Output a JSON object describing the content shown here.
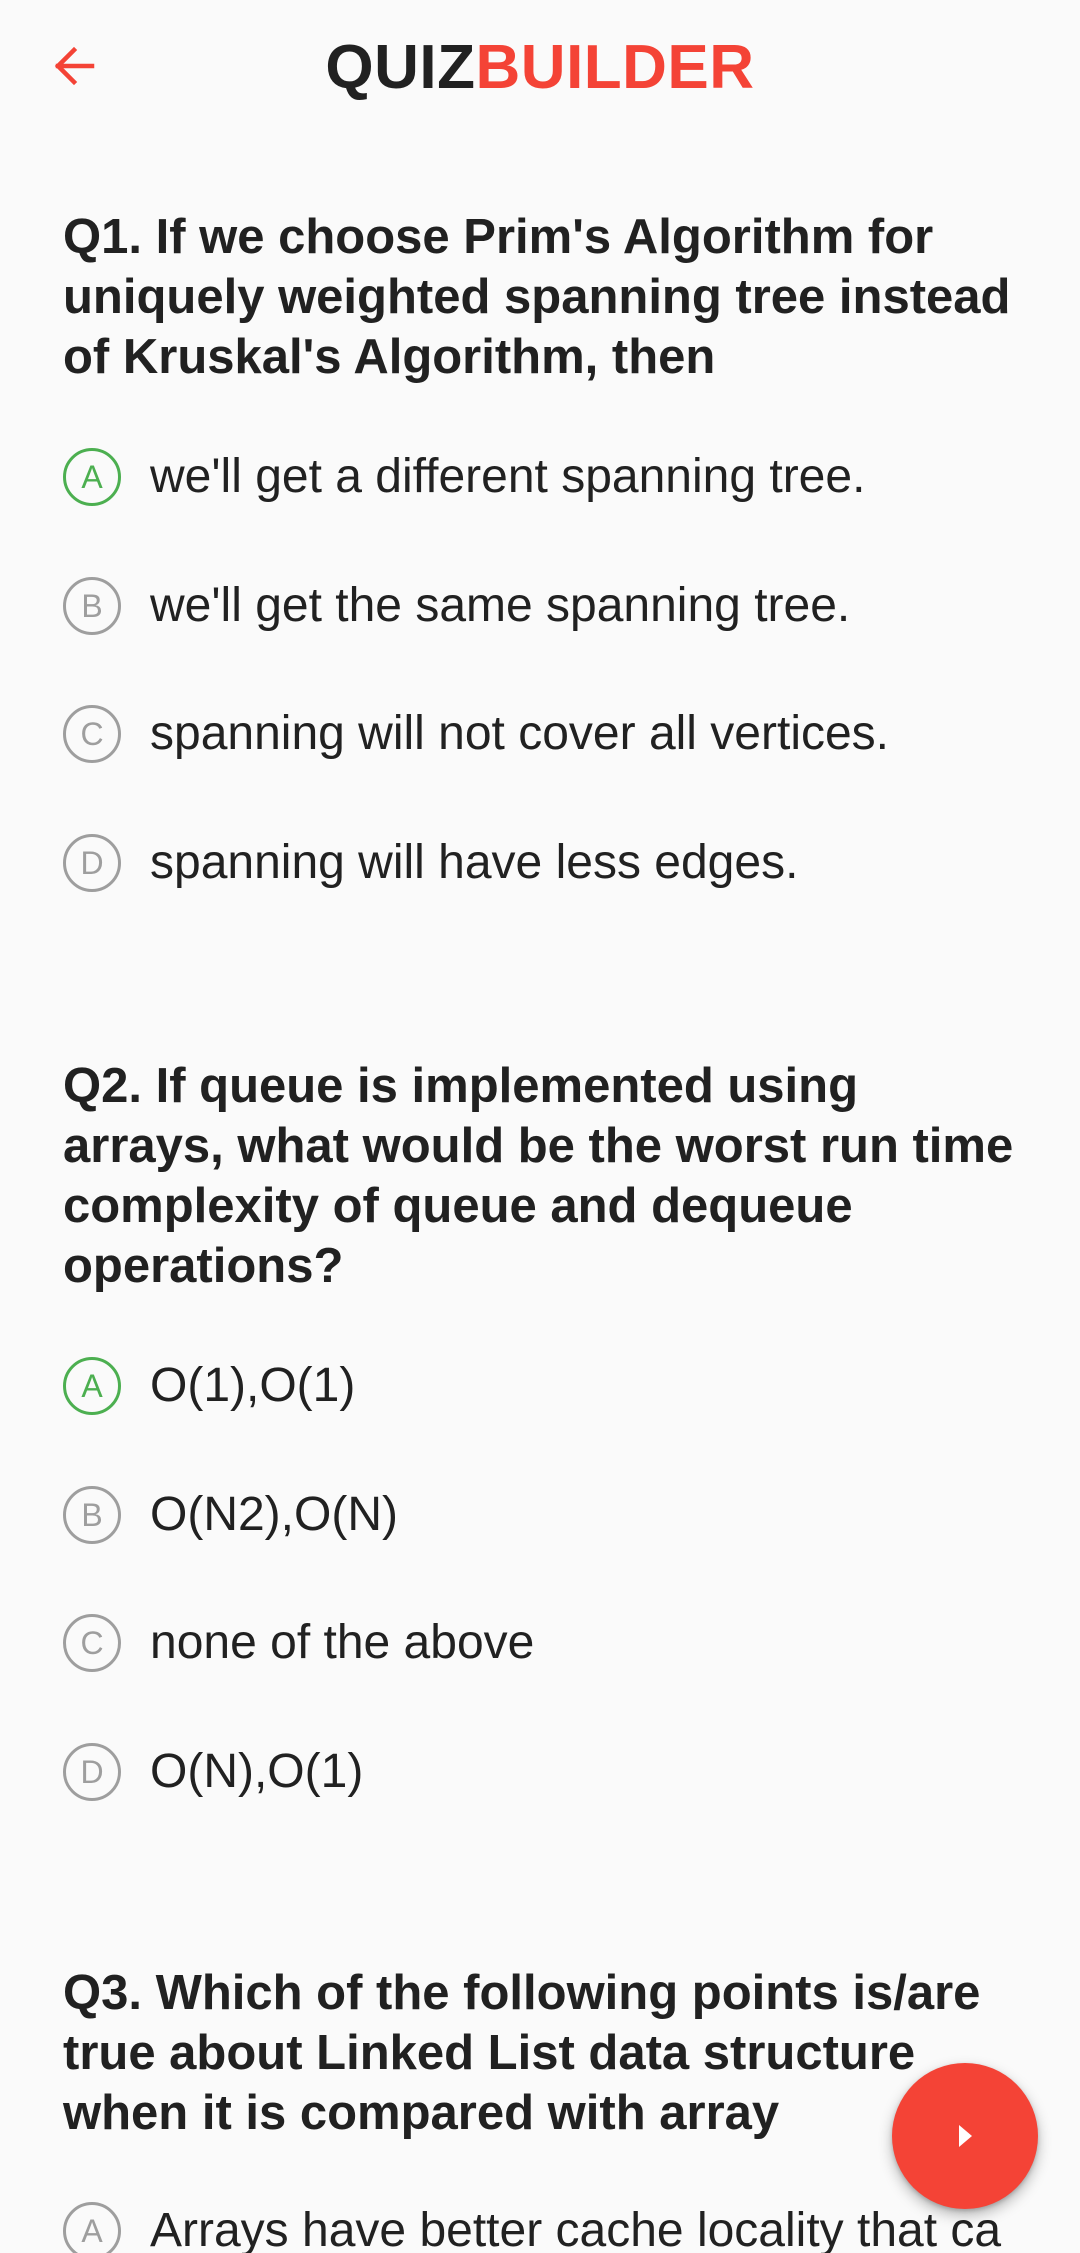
{
  "header": {
    "brand_part1": "QUIZ",
    "brand_part2": "BUILDER",
    "back_icon": "arrow-left-icon",
    "accent_color": "#f44336"
  },
  "questions": [
    {
      "text": "Q1. If we choose Prim's Algorithm for uniquely weighted spanning tree instead of Kruskal's Algorithm, then",
      "options": [
        {
          "letter": "A",
          "text": "we'll get a different spanning tree.",
          "highlighted": true
        },
        {
          "letter": "B",
          "text": "we'll get the same spanning tree.",
          "highlighted": false
        },
        {
          "letter": "C",
          "text": "spanning will not cover all vertices.",
          "highlighted": false
        },
        {
          "letter": "D",
          "text": "spanning will have less edges.",
          "highlighted": false
        }
      ]
    },
    {
      "text": "Q2. If queue is implemented using arrays, what would be the worst run time complexity of queue and dequeue operations?",
      "options": [
        {
          "letter": "A",
          "text": "O(1),O(1)",
          "highlighted": true
        },
        {
          "letter": "B",
          "text": "O(N2),O(N)",
          "highlighted": false
        },
        {
          "letter": "C",
          "text": "none of the above",
          "highlighted": false
        },
        {
          "letter": "D",
          "text": "O(N),O(1)",
          "highlighted": false
        }
      ]
    },
    {
      "text": "Q3. Which of the following points is/are true about Linked List data structure when it is compared with array",
      "options": [
        {
          "letter": "A",
          "text": "Arrays have better cache locality that ca",
          "highlighted": false
        }
      ]
    }
  ],
  "fab": {
    "icon": "play-arrow-icon",
    "color": "#f44336"
  },
  "colors": {
    "correct": "#4caf50",
    "neutral": "#9e9e9e",
    "background": "#fafafa"
  }
}
